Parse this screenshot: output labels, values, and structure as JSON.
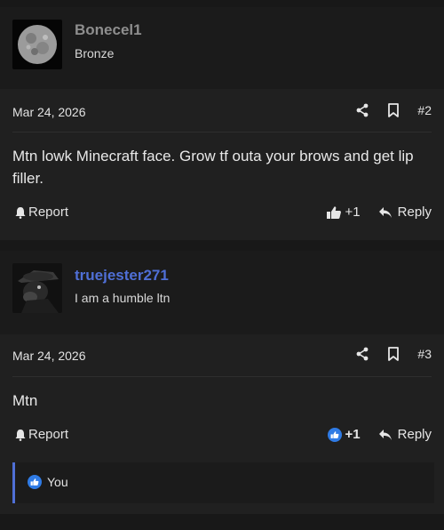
{
  "posts": [
    {
      "username": "Bonecel1",
      "user_title": "Bronze",
      "date": "Mar 24, 2026",
      "post_number": "#2",
      "content": "Mtn lowk Minecraft face. Grow tf outa your brows and get lip filler.",
      "report_label": "Report",
      "like_count": "+1",
      "reply_label": "Reply"
    },
    {
      "username": "truejester271",
      "user_title": "I am a humble ltn",
      "date": "Mar 24, 2026",
      "post_number": "#3",
      "content": "Mtn",
      "report_label": "Report",
      "like_count": "+1",
      "reply_label": "Reply",
      "reaction_users": "You"
    }
  ],
  "colors": {
    "background": "#181818",
    "card": "#202020",
    "user_link": "#4f6fd6",
    "like_blue": "#2f7be5"
  }
}
